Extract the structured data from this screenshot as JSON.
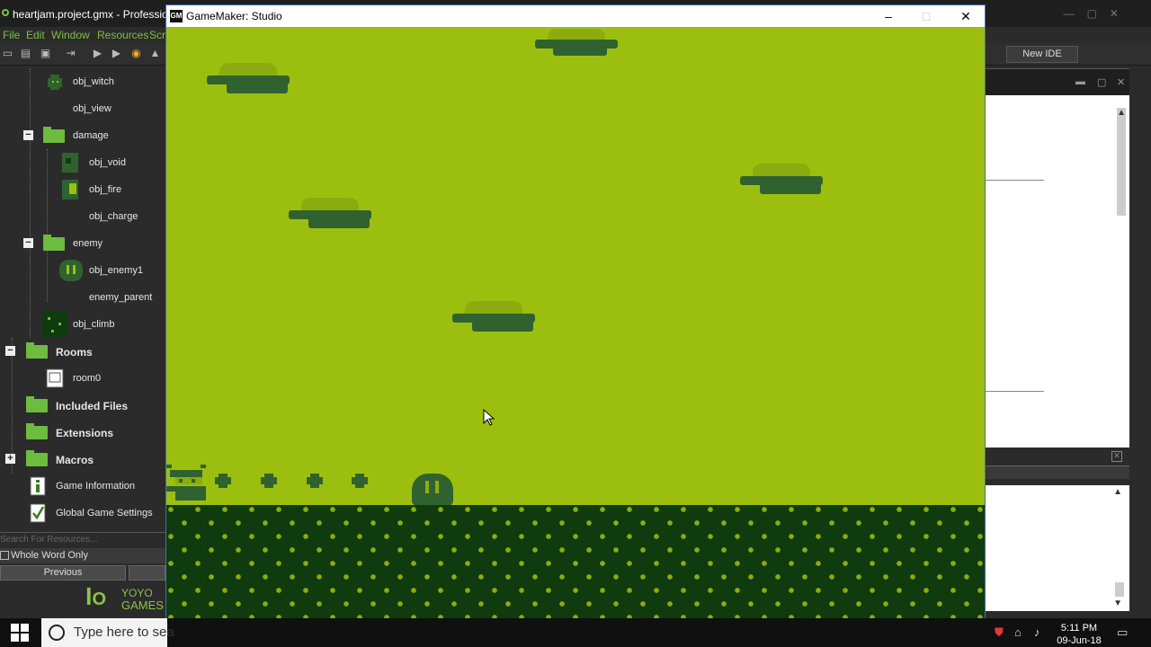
{
  "ide": {
    "title": "heartjam.project.gmx - Professio",
    "menu": [
      "File",
      "Edit",
      "Window",
      "Resources",
      "Scr"
    ],
    "new_ide_label": "New IDE",
    "tree": [
      {
        "label": "obj_witch",
        "kind": "object",
        "icon": "witch-sprite-icon"
      },
      {
        "label": "obj_view",
        "kind": "object",
        "icon": "none"
      },
      {
        "label": "damage",
        "kind": "folder",
        "toggle": "−"
      },
      {
        "label": "obj_void",
        "kind": "object",
        "icon": "void-sprite-icon"
      },
      {
        "label": "obj_fire",
        "kind": "object",
        "icon": "fire-sprite-icon"
      },
      {
        "label": "obj_charge",
        "kind": "object",
        "icon": "none"
      },
      {
        "label": "enemy",
        "kind": "folder",
        "toggle": "−"
      },
      {
        "label": "obj_enemy1",
        "kind": "object",
        "icon": "enemy-sprite-icon"
      },
      {
        "label": "enemy_parent",
        "kind": "object",
        "icon": "none"
      },
      {
        "label": "obj_climb",
        "kind": "object",
        "icon": "climb-sprite-icon"
      },
      {
        "label": "Rooms",
        "kind": "root-folder",
        "toggle": "−"
      },
      {
        "label": "room0",
        "kind": "room",
        "icon": "room-icon"
      },
      {
        "label": "Included Files",
        "kind": "root-folder"
      },
      {
        "label": "Extensions",
        "kind": "root-folder"
      },
      {
        "label": "Macros",
        "kind": "root-folder",
        "toggle": "+"
      },
      {
        "label": "Game Information",
        "kind": "item",
        "icon": "info-icon"
      },
      {
        "label": "Global Game Settings",
        "kind": "item",
        "icon": "settings-check-icon"
      }
    ],
    "search_placeholder": "Search For Resources...",
    "whole_word_label": "Whole Word Only",
    "previous_label": "Previous",
    "logo_line1": "YOYO",
    "logo_line2": "GAMES"
  },
  "game_window": {
    "title": "GameMaker: Studio",
    "minimize": "–",
    "maximize": "□",
    "close": "✕",
    "colors": {
      "sky": "#9cbf0f",
      "light": "#8bac0f",
      "dark": "#306230",
      "darkest": "#0f3b0f"
    }
  },
  "taskbar": {
    "search_placeholder": "Type here to sea",
    "time": "5:11 PM",
    "date": "09-Jun-18"
  }
}
